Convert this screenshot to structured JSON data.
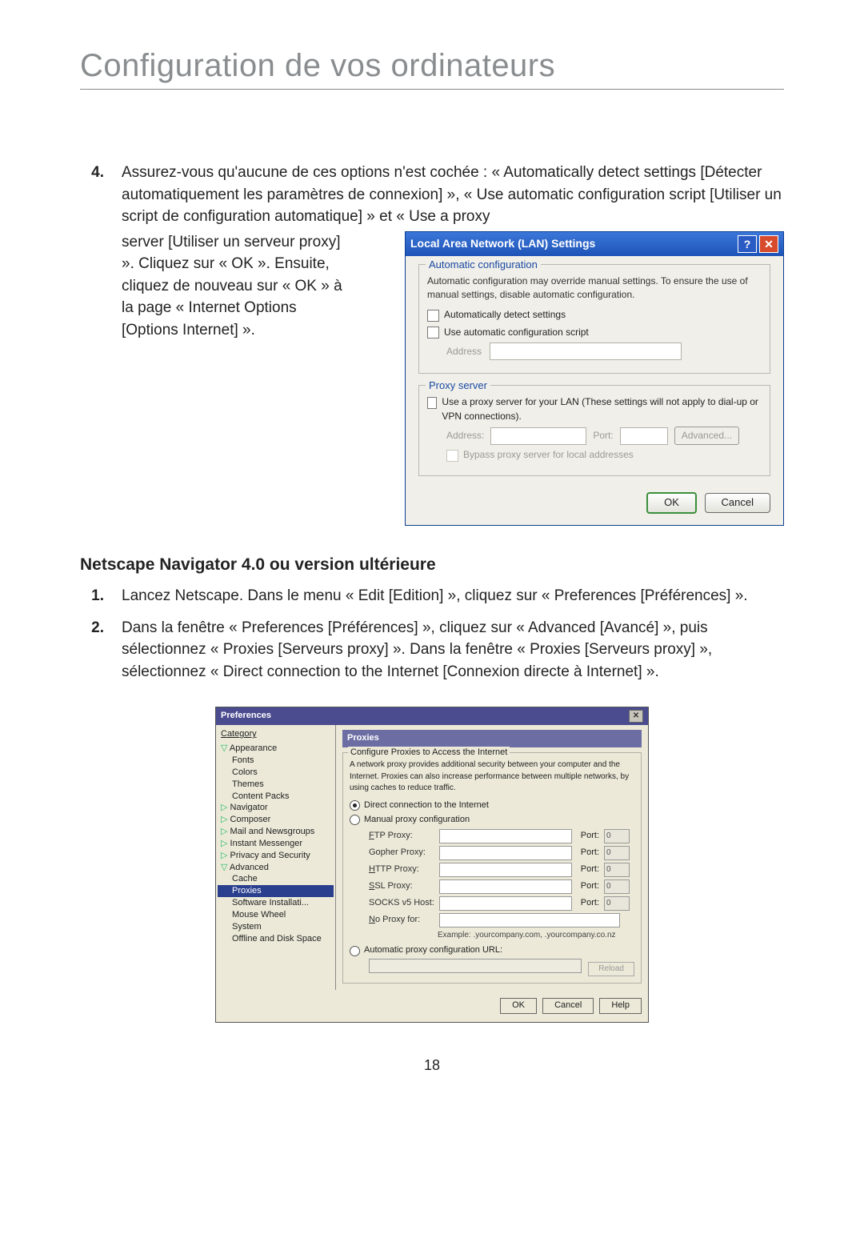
{
  "page": {
    "title": "Configuration de vos ordinateurs",
    "number": "18"
  },
  "step4": {
    "num": "4.",
    "intro": "Assurez-vous qu'aucune de ces options n'est cochée : « Automatically detect settings [Détecter automatiquement les paramètres de connexion] », « Use automatic configuration script [Utiliser un script de configuration automatique] » et « Use a proxy",
    "cont": "server [Utiliser un serveur proxy] ». Cliquez sur « OK ». Ensuite, cliquez de nouveau sur « OK » à la page « Internet Options [Options Internet] »."
  },
  "lan": {
    "title": "Local Area Network (LAN) Settings",
    "auto": {
      "legend": "Automatic configuration",
      "desc": "Automatic configuration may override manual settings.  To ensure the use of manual settings, disable automatic configuration.",
      "detect": "Automatically detect settings",
      "script": "Use automatic configuration script",
      "addr_label": "Address"
    },
    "proxy": {
      "legend": "Proxy server",
      "use": "Use a proxy server for your LAN (These settings will not apply to dial-up or VPN connections).",
      "addr_label": "Address:",
      "port_label": "Port:",
      "advanced": "Advanced...",
      "bypass": "Bypass proxy server for local addresses"
    },
    "ok": "OK",
    "cancel": "Cancel"
  },
  "netscape": {
    "heading": "Netscape Navigator 4.0 ou version ultérieure",
    "step1_num": "1.",
    "step1": "Lancez Netscape. Dans le menu « Edit [Edition] », cliquez sur « Preferences [Préférences] ».",
    "step2_num": "2.",
    "step2": "Dans la fenêtre « Preferences [Préférences] », cliquez sur « Advanced [Avancé] », puis sélectionnez « Proxies [Serveurs proxy] ». Dans la fenêtre « Proxies [Serveurs proxy] », sélectionnez « Direct connection to the Internet [Connexion directe à Internet] »."
  },
  "prefs": {
    "title": "Preferences",
    "category": "Category",
    "tree": {
      "appearance": "Appearance",
      "fonts": "Fonts",
      "colors": "Colors",
      "themes": "Themes",
      "contentpacks": "Content Packs",
      "navigator": "Navigator",
      "composer": "Composer",
      "mail": "Mail and Newsgroups",
      "im": "Instant Messenger",
      "privacy": "Privacy and Security",
      "advanced": "Advanced",
      "cache": "Cache",
      "proxies": "Proxies",
      "software": "Software Installati...",
      "mouse": "Mouse Wheel",
      "system": "System",
      "offline": "Offline and Disk Space"
    },
    "panel": {
      "title": "Proxies",
      "legend": "Configure Proxies to Access the Internet",
      "desc": "A network proxy provides additional security between your computer and the Internet. Proxies can also increase performance between multiple networks, by using caches to reduce traffic.",
      "direct": "Direct connection to the Internet",
      "manual": "Manual proxy configuration",
      "ftp": "FTP Proxy:",
      "gopher": "Gopher Proxy:",
      "http": "HTTP Proxy:",
      "ssl": "SSL Proxy:",
      "socks": "SOCKS v5 Host:",
      "noproxy": "No Proxy for:",
      "port": "Port:",
      "portval": "0",
      "example": "Example: .yourcompany.com, .yourcompany.co.nz",
      "auto": "Automatic proxy configuration URL:",
      "reload": "Reload"
    },
    "ok": "OK",
    "cancel": "Cancel",
    "help": "Help"
  }
}
